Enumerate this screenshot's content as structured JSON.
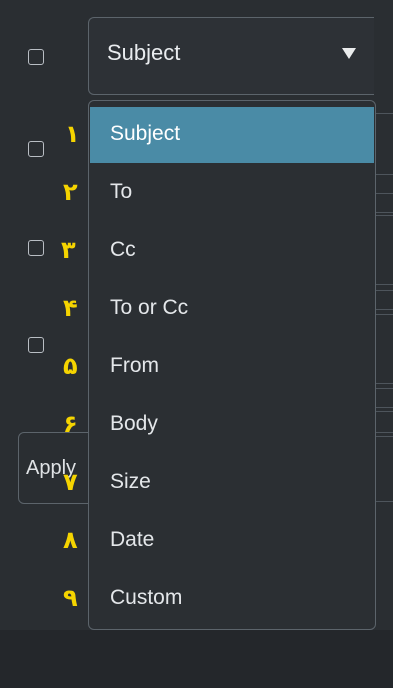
{
  "combo": {
    "selected_label": "Subject",
    "arrow_icon": "triangle-down-icon"
  },
  "apply_button": {
    "label": "Apply"
  },
  "dropdown": {
    "options": [
      {
        "label": "Subject",
        "selected": true
      },
      {
        "label": "To",
        "selected": false
      },
      {
        "label": "Cc",
        "selected": false
      },
      {
        "label": "To or Cc",
        "selected": false
      },
      {
        "label": "From",
        "selected": false
      },
      {
        "label": "Body",
        "selected": false
      },
      {
        "label": "Size",
        "selected": false
      },
      {
        "label": "Date",
        "selected": false
      },
      {
        "label": "Custom",
        "selected": false
      }
    ]
  },
  "annotations": [
    "١",
    "٢",
    "٣",
    "۴",
    "۵",
    "۶",
    "٧",
    "٨",
    "٩"
  ],
  "colors": {
    "background": "#2a2e32",
    "selected_option": "#4a8ba6",
    "annotation": "#f5d400",
    "border": "#5c646b"
  }
}
